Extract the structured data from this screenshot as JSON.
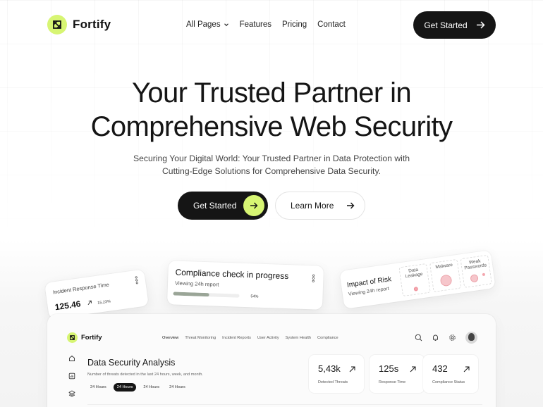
{
  "brand": {
    "name": "Fortify",
    "accent": "#d7f573",
    "dark": "#151515"
  },
  "nav": {
    "items": [
      {
        "label": "All Pages",
        "has_dropdown": true
      },
      {
        "label": "Features"
      },
      {
        "label": "Pricing"
      },
      {
        "label": "Contact"
      }
    ],
    "cta": "Get Started"
  },
  "hero": {
    "title_line1": "Your Trusted Partner in",
    "title_line2": "Comprehensive Web Security",
    "subtitle_line1": "Securing Your Digital World: Your Trusted Partner in Data Protection with",
    "subtitle_line2": "Cutting-Edge Solutions for Comprehensive Data Security.",
    "primary_button": "Get Started",
    "secondary_button": "Learn More"
  },
  "cards": {
    "incident": {
      "label": "Incident Response Time",
      "value": "125.46",
      "change": "15.23%"
    },
    "compliance": {
      "title": "Compliance check in progress",
      "subtitle": "Viewing 24h report",
      "progress_percent": 54,
      "progress_label": "54%"
    },
    "impact": {
      "title": "Impact of Risk",
      "subtitle": "Viewing 24h report",
      "risks": [
        {
          "label_line1": "Data",
          "label_line2": "Leakage"
        },
        {
          "label_line1": "Malware",
          "label_line2": ""
        },
        {
          "label_line1": "Weak",
          "label_line2": "Passwords"
        }
      ]
    }
  },
  "dashboard": {
    "brand": "Fortify",
    "tabs": [
      "Overview",
      "Threat Monitoring",
      "Incident Reports",
      "User Activity",
      "System Health",
      "Compliance"
    ],
    "active_tab": "Overview",
    "title": "Data Security Analysis",
    "subtitle": "Number of threats detected in the last 24 hours, week, and month.",
    "pills": [
      "24 Hours",
      "24 Hours",
      "24 Hours",
      "24 Hours"
    ],
    "active_pill": 1,
    "stats": [
      {
        "value": "5,43k",
        "label": "Detected Threats"
      },
      {
        "value": "125s",
        "label": "Response Time"
      },
      {
        "value": "432",
        "label": "Compliance Status"
      }
    ]
  }
}
